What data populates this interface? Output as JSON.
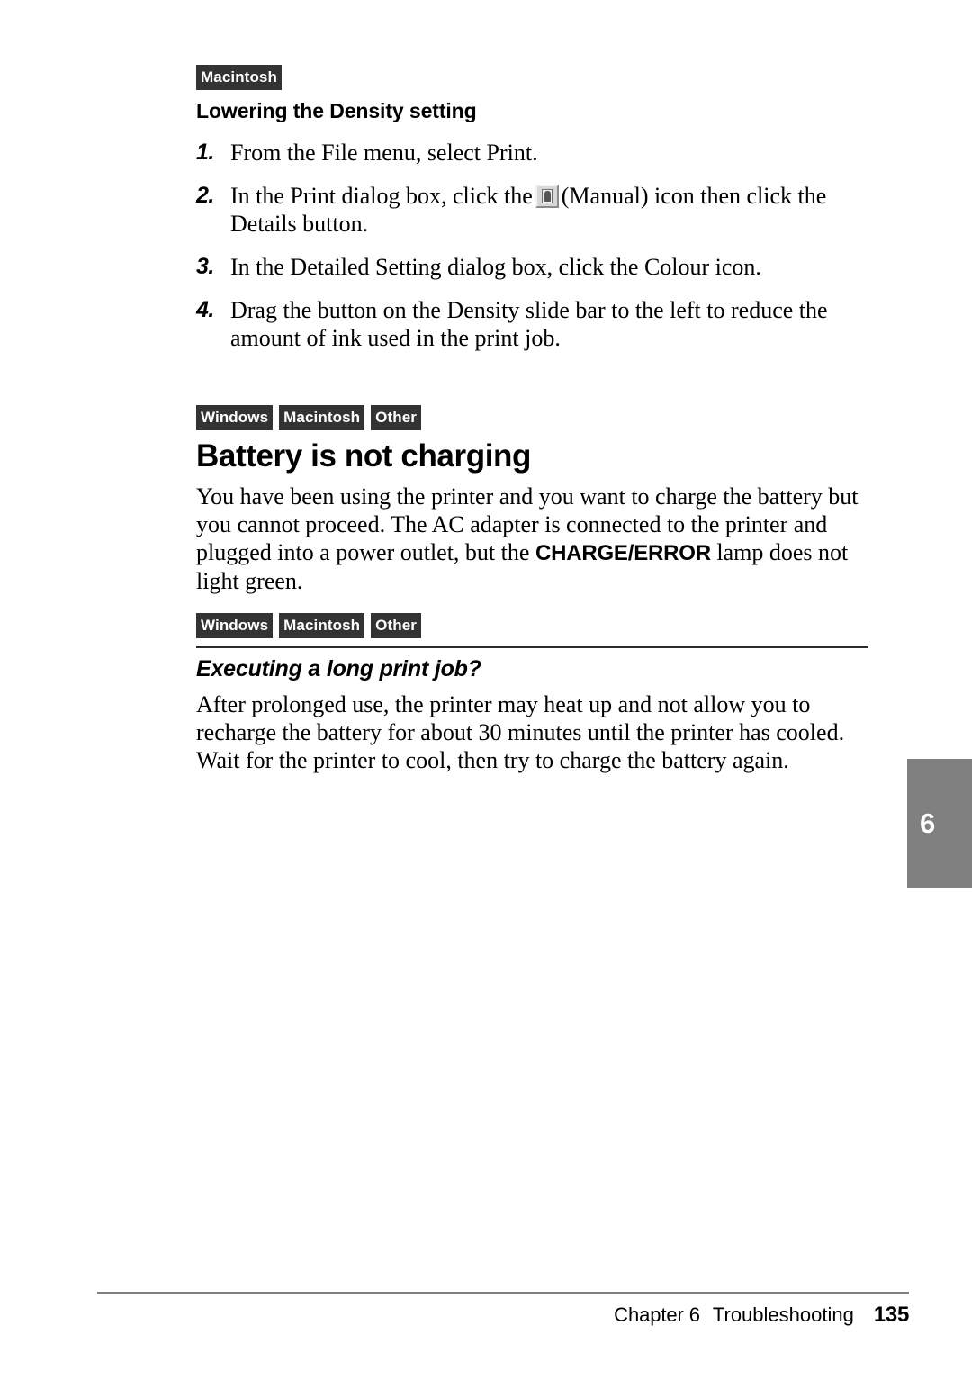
{
  "section_macintosh": {
    "tags": [
      "Macintosh"
    ],
    "heading": "Lowering the Density setting",
    "steps": [
      {
        "number": "1.",
        "text_before": "From the File menu, select Print.",
        "icon": null,
        "text_after": ""
      },
      {
        "number": "2.",
        "text_before": "In the Print dialog box, click the",
        "icon": "manual-icon",
        "text_after": "(Manual) icon then click the Details button."
      },
      {
        "number": "3.",
        "text_before": "In the Detailed Setting dialog box, click the Colour icon.",
        "icon": null,
        "text_after": ""
      },
      {
        "number": "4.",
        "text_before": "Drag the button on the Density slide bar to the left to reduce the amount of ink used in the print job.",
        "icon": null,
        "text_after": ""
      }
    ]
  },
  "section_battery": {
    "tags": [
      "Windows",
      "Macintosh",
      "Other"
    ],
    "heading": "Battery is not charging",
    "body_part1": "You have been using the printer and you want to charge the battery but you cannot proceed. The AC adapter is connected to the printer and plugged into a power outlet, but the ",
    "body_emphasis": "CHARGE/ERROR",
    "body_part2": " lamp does not light green."
  },
  "section_long_job": {
    "tags": [
      "Windows",
      "Macintosh",
      "Other"
    ],
    "heading": "Executing a long print job?",
    "body": "After prolonged use, the printer may heat up and not allow you to recharge the battery for about 30 minutes until the printer has cooled. Wait for the printer to cool, then try to charge the battery again."
  },
  "thumb_tab": {
    "label": "6"
  },
  "footer": {
    "chapter": "Chapter 6",
    "title": "Troubleshooting",
    "page_number": "135"
  },
  "colors": {
    "tag_background": "#333333",
    "thumb_tab_background": "#808080",
    "rule": "#2b2b2b",
    "footer_rule": "#808080"
  }
}
